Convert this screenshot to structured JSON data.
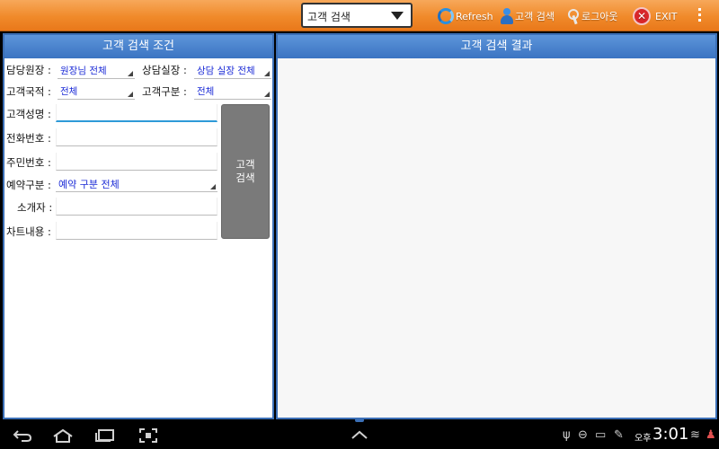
{
  "topbar": {
    "menu_select_value": "고객 검색",
    "refresh_label": "Refresh",
    "customer_search_label": "고객 검색",
    "logout_label": "로그아웃",
    "exit_label": "EXIT",
    "icons": [
      "refresh-icon",
      "user-icon",
      "key-icon",
      "exit-icon",
      "overflow-menu-icon"
    ]
  },
  "search_panel": {
    "title": "고객 검색 조건",
    "director_label": "담당원장 :",
    "director_value": "원장님 전체",
    "manager_label": "상담실장 :",
    "manager_value": "상담 실장 전체",
    "nationality_label": "고객국적 :",
    "nationality_value": "전체",
    "category_label": "고객구분 :",
    "category_value": "전체",
    "name_label": "고객성명 :",
    "name_value": "",
    "phone_label": "전화번호 :",
    "phone_value": "",
    "id_label": "주민번호 :",
    "id_value": "",
    "reservation_label": "예약구분 :",
    "reservation_value": "예약 구분 전체",
    "referrer_label": "소개자 :",
    "referrer_value": "",
    "chart_label": "차트내용 :",
    "chart_value": "",
    "search_button": "고객\n검색"
  },
  "results_panel": {
    "title": "고객 검색 결과"
  },
  "system_bar": {
    "ampm": "오후",
    "time": "3:01",
    "icons": [
      "back-icon",
      "home-icon",
      "recent-apps-icon",
      "screenshot-icon",
      "up-chevron-icon",
      "usb-icon",
      "block-icon",
      "battery-icon",
      "pen-icon",
      "wifi-icon",
      "notification-icon"
    ]
  },
  "colors": {
    "topbar": "#f08a2a",
    "panel_header": "#3b74c2",
    "search_button": "#7a7a7a",
    "select_value_text": "#1a2ad6"
  }
}
